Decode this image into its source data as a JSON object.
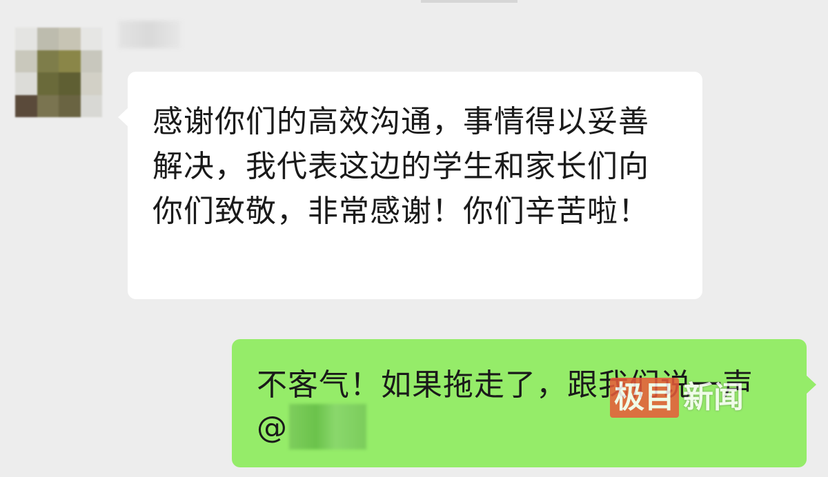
{
  "chat": {
    "messages": [
      {
        "side": "received",
        "text": "感谢你们的高效沟通，事情得以妥善解决，我代表这边的学生和家长们向你们致敬，非常感谢！你们辛苦啦！"
      },
      {
        "side": "sent",
        "text": "不客气！如果拖走了，跟我们说一声 @"
      }
    ]
  },
  "watermark": {
    "brand_box": "极目",
    "brand_text": "新闻"
  },
  "colors": {
    "background": "#ededed",
    "received_bubble": "#ffffff",
    "sent_bubble": "#95ec69",
    "watermark_red": "#e85b3a"
  }
}
